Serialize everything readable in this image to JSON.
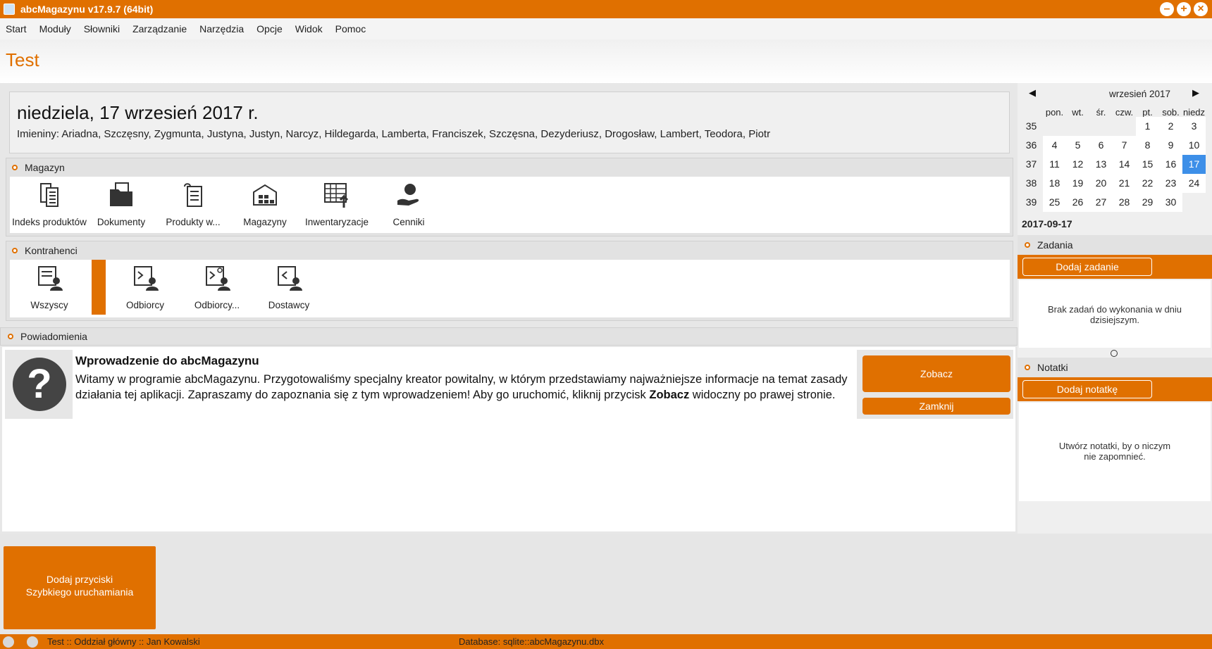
{
  "app": {
    "title": "abcMagazynu v17.9.7 (64bit)"
  },
  "window_buttons": [
    "–",
    "+",
    "×"
  ],
  "menu": [
    "Start",
    "Moduły",
    "Słowniki",
    "Zarządzanie",
    "Narzędzia",
    "Opcje",
    "Widok",
    "Pomoc"
  ],
  "page": {
    "title": "Test"
  },
  "date_panel": {
    "date": "niedziela, 17 wrzesień 2017 r.",
    "namedays": "Imieniny: Ariadna, Szczęsny, Zygmunta, Justyna, Justyn, Narcyz, Hildegarda, Lamberta, Franciszek, Szczęsna, Dezyderiusz, Drogosław, Lambert, Teodora, Piotr"
  },
  "magazyn": {
    "title": "Magazyn",
    "tiles": [
      {
        "label": "Indeks produktów",
        "icon": "product-index-icon"
      },
      {
        "label": "Dokumenty",
        "icon": "documents-folder-icon"
      },
      {
        "label": "Produkty w...",
        "icon": "products-list-icon"
      },
      {
        "label": "Magazyny",
        "icon": "warehouse-icon"
      },
      {
        "label": "Inwentaryzacje",
        "icon": "inventory-icon"
      },
      {
        "label": "Cenniki",
        "icon": "price-list-icon"
      }
    ]
  },
  "kontrahenci": {
    "title": "Kontrahenci",
    "tiles": [
      {
        "label": "Wszyscy",
        "icon": "all-contractors-icon"
      },
      {
        "label": "Odbiorcy",
        "icon": "recipients-icon"
      },
      {
        "label": "Odbiorcy...",
        "icon": "recipients-more-icon"
      },
      {
        "label": "Dostawcy",
        "icon": "suppliers-icon"
      }
    ]
  },
  "powiadomienia": {
    "title": "Powiadomienia",
    "heading": "Wprowadzenie do abcMagazynu",
    "text_before": "Witamy w programie abcMagazynu. Przygotowaliśmy specjalny kreator powitalny, w którym przedstawiamy najważniejsze informacje na temat zasady działania tej aplikacji. Zapraszamy do zapoznania się z tym wprowadzeniem! Aby go uruchomić, kliknij przycisk ",
    "text_bold": "Zobacz",
    "text_after": " widoczny po prawej stronie.",
    "show_label": "Zobacz",
    "close_label": "Zamknij"
  },
  "quick_start": {
    "line1": "Dodaj przyciski",
    "line2": "Szybkiego uruchamiania"
  },
  "status": {
    "user": "Test :: Oddział główny :: Jan Kowalski",
    "database": "Database: sqlite::abcMagazynu.dbx"
  },
  "calendar": {
    "month": "wrzesień 2017",
    "weekdays": [
      "pon.",
      "wt.",
      "śr.",
      "czw.",
      "pt.",
      "sob.",
      "niedz"
    ],
    "weeks": [
      {
        "week": "35",
        "days": [
          "",
          "",
          "",
          "",
          "1",
          "2",
          "3"
        ]
      },
      {
        "week": "36",
        "days": [
          "4",
          "5",
          "6",
          "7",
          "8",
          "9",
          "10"
        ]
      },
      {
        "week": "37",
        "days": [
          "11",
          "12",
          "13",
          "14",
          "15",
          "16",
          "17"
        ]
      },
      {
        "week": "38",
        "days": [
          "18",
          "19",
          "20",
          "21",
          "22",
          "23",
          "24"
        ]
      },
      {
        "week": "39",
        "days": [
          "25",
          "26",
          "27",
          "28",
          "29",
          "30",
          ""
        ]
      }
    ],
    "selected_day": "17",
    "selected_date": "2017-09-17"
  },
  "zadania": {
    "title": "Zadania",
    "add_label": "Dodaj zadanie",
    "empty_text": "Brak zadań do wykonania w dniu dzisiejszym."
  },
  "notatki": {
    "title": "Notatki",
    "add_label": "Dodaj notatkę",
    "empty_text_line1": "Utwórz notatki, by o niczym",
    "empty_text_line2": "nie zapomnieć."
  },
  "colors": {
    "accent": "#e07000",
    "selected": "#3d8fe8"
  }
}
